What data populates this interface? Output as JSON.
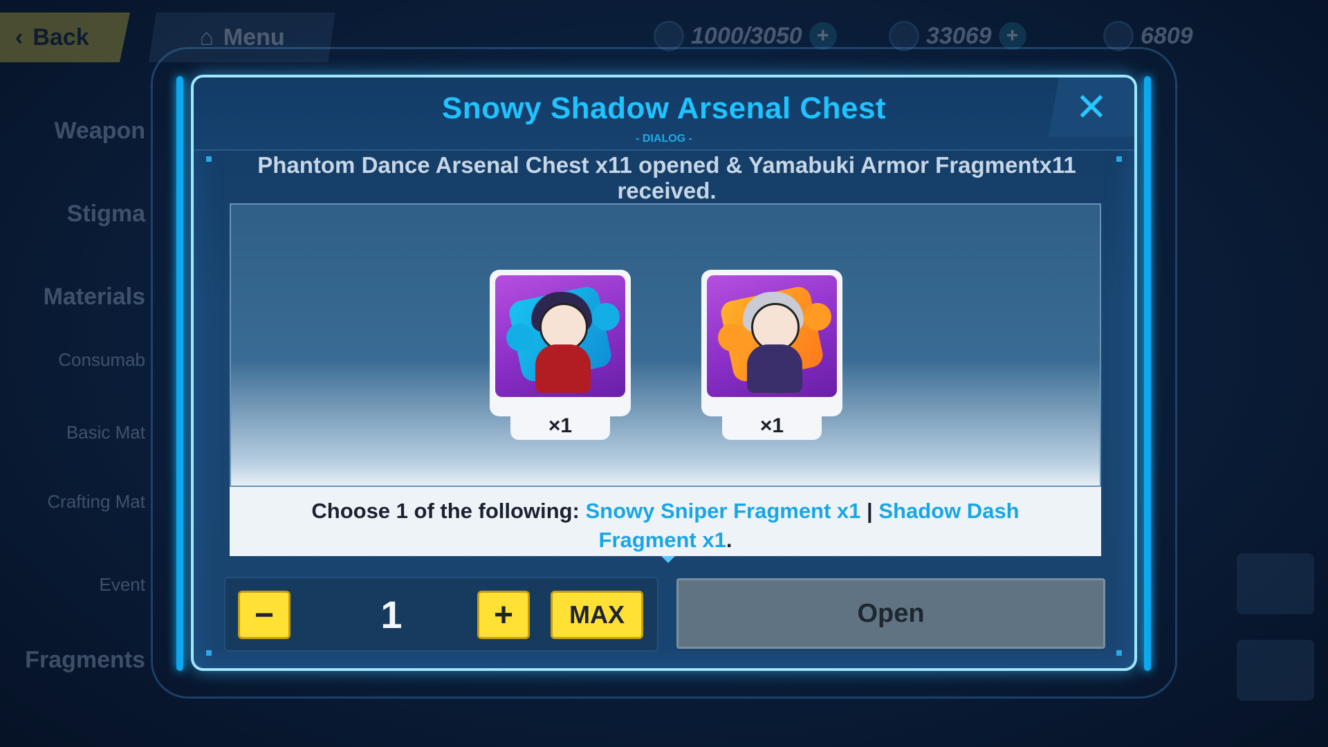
{
  "background": {
    "back_label": "Back",
    "menu_label": "Menu",
    "resources": [
      {
        "icon": "stamina-icon",
        "value": "1000/3050"
      },
      {
        "icon": "crystal-icon",
        "value": "33069"
      },
      {
        "icon": "coin-icon",
        "value": "6809"
      }
    ],
    "sidebar": [
      "Weapon",
      "Stigma",
      "Materials",
      "Consumab",
      "Basic Mat",
      "Crafting Mat",
      "Event",
      "Fragments"
    ]
  },
  "dialog": {
    "title": "Snowy Shadow Arsenal Chest",
    "subtitle": "- DIALOG -",
    "close_glyph": "✕",
    "message": "Phantom Dance Arsenal Chest x11 opened & Yamabuki Armor Fragmentx11 received.",
    "rewards": [
      {
        "name": "Snowy Sniper Fragment",
        "quantity": "×1",
        "theme": "puzzle-blue"
      },
      {
        "name": "Shadow Dash Fragment",
        "quantity": "×1",
        "theme": "puzzle-orange"
      }
    ],
    "choose": {
      "prefix": "Choose 1 of the following:",
      "option1": "Snowy Sniper Fragment x1",
      "separator": "|",
      "option2": "Shadow Dash Fragment x1",
      "suffix": "."
    },
    "quantity": {
      "minus": "−",
      "value": "1",
      "plus": "+",
      "max_label": "MAX"
    },
    "open_label": "Open"
  },
  "colors": {
    "accent": "#1fc3ff",
    "button_yellow": "#ffe034",
    "open_disabled": "#5f7382"
  }
}
